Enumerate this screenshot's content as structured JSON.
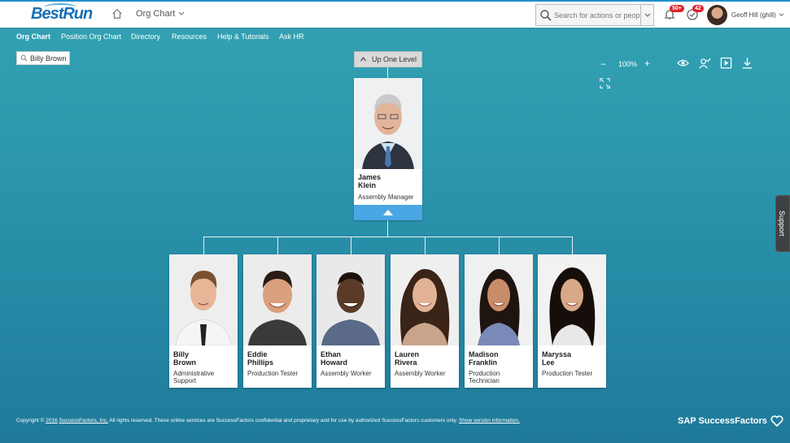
{
  "header": {
    "logo_text": "BestRun",
    "module_label": "Org Chart",
    "search_placeholder": "Search for actions or people",
    "notifications_badge": "50+",
    "todo_badge": "42",
    "user_name": "Geoff Hill (ghill)",
    "accent_color": "#1f8ecf",
    "badge_color": "#e0202a"
  },
  "nav": {
    "items": [
      {
        "label": "Org Chart"
      },
      {
        "label": "Position Org Chart"
      },
      {
        "label": "Directory"
      },
      {
        "label": "Resources"
      },
      {
        "label": "Help & Tutorials"
      },
      {
        "label": "Ask HR"
      }
    ]
  },
  "person_search": {
    "value": "Billy Brown"
  },
  "up_level_label": "Up One Level",
  "toolbar": {
    "zoom_minus": "−",
    "zoom_level": "100%",
    "zoom_plus": "+",
    "icons": [
      "eye-icon",
      "person-check-icon",
      "play-icon",
      "download-icon",
      "fullscreen-icon"
    ]
  },
  "manager": {
    "first_name": "James",
    "last_name": "Klein",
    "title": "Assembly Manager"
  },
  "reports": [
    {
      "first_name": "Billy",
      "last_name": "Brown",
      "title_line1": "Administrative",
      "title_line2": "Support"
    },
    {
      "first_name": "Eddie",
      "last_name": "Phillips",
      "title_line1": "Production Tester",
      "title_line2": ""
    },
    {
      "first_name": "Ethan",
      "last_name": "Howard",
      "title_line1": "Assembly Worker",
      "title_line2": ""
    },
    {
      "first_name": "Lauren",
      "last_name": "Rivera",
      "title_line1": "Assembly Worker",
      "title_line2": ""
    },
    {
      "first_name": "Madison",
      "last_name": "Franklin",
      "title_line1": "Production",
      "title_line2": "Technician"
    },
    {
      "first_name": "Maryssa",
      "last_name": "Lee",
      "title_line1": "Production Tester",
      "title_line2": ""
    }
  ],
  "support_label": "Support",
  "footer": {
    "prefix": "Copyright © ",
    "year_link": "2016",
    "company_link": "SuccessFactors, Inc.",
    "rights_text": " All rights reserved. These online services are SuccessFactors confidential and proprietary and for use by authorized SuccessFactors customers only. ",
    "version_link": "Show version information.",
    "brand": "SAP SuccessFactors"
  }
}
